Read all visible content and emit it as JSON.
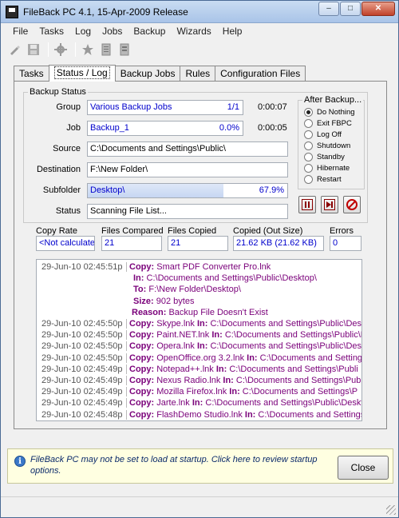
{
  "window": {
    "title": "FileBack PC 4.1, 15-Apr-2009 Release",
    "min": "–",
    "max": "□",
    "close": "✕"
  },
  "menu": [
    "File",
    "Tasks",
    "Log",
    "Jobs",
    "Backup",
    "Wizards",
    "Help"
  ],
  "toolbar": [
    "new-job-icon",
    "save-icon",
    "settings-icon",
    "favorite-icon",
    "document-icon",
    "document-list-icon"
  ],
  "tabs": [
    {
      "label": "Tasks",
      "active": false
    },
    {
      "label": "Status / Log",
      "active": true
    },
    {
      "label": "Backup Jobs",
      "active": false
    },
    {
      "label": "Rules",
      "active": false
    },
    {
      "label": "Configuration Files",
      "active": false
    }
  ],
  "backup_status": {
    "title": "Backup Status",
    "group": {
      "label": "Group",
      "value": "Various Backup Jobs",
      "count": "1/1",
      "time": "0:00:07"
    },
    "job": {
      "label": "Job",
      "value": "Backup_1",
      "percent": "0.0%",
      "progress": 0.0,
      "time": "0:00:05"
    },
    "source": {
      "label": "Source",
      "value": "C:\\Documents and Settings\\Public\\"
    },
    "destination": {
      "label": "Destination",
      "value": "F:\\New Folder\\"
    },
    "subfolder": {
      "label": "Subfolder",
      "value": "Desktop\\",
      "percent": "67.9%",
      "progress": 0.679
    },
    "status": {
      "label": "Status",
      "value": "Scanning File List..."
    }
  },
  "after_backup": {
    "title": "After Backup...",
    "options": [
      {
        "label": "Do Nothing",
        "selected": true
      },
      {
        "label": "Exit FBPC",
        "selected": false
      },
      {
        "label": "Log Off",
        "selected": false
      },
      {
        "label": "Shutdown",
        "selected": false
      },
      {
        "label": "Standby",
        "selected": false
      },
      {
        "label": "Hibernate",
        "selected": false
      },
      {
        "label": "Restart",
        "selected": false
      }
    ]
  },
  "controls": [
    "pause-icon",
    "skip-icon",
    "stop-icon"
  ],
  "stats": {
    "copy_rate": {
      "label": "Copy Rate",
      "value": "<Not calculate"
    },
    "files_compared": {
      "label": "Files Compared",
      "value": "21"
    },
    "files_copied": {
      "label": "Files Copied",
      "value": "21"
    },
    "copied_size": {
      "label": "Copied (Out Size)",
      "value": "21.62 KB (21.62 KB)"
    },
    "errors": {
      "label": "Errors",
      "value": "0"
    }
  },
  "log": [
    {
      "ts": "29-Jun-10 02:45:51p",
      "kw": "Copy:",
      "text": "Smart PDF Converter Pro.lnk"
    },
    {
      "ts": "",
      "kw": "In:",
      "text": "C:\\Documents and Settings\\Public\\Desktop\\"
    },
    {
      "ts": "",
      "kw": "To:",
      "text": "F:\\New Folder\\Desktop\\"
    },
    {
      "ts": "",
      "kw": "Size:",
      "text": "902 bytes"
    },
    {
      "ts": "",
      "kw": "Reason:",
      "text": "Backup File Doesn't Exist"
    },
    {
      "ts": "29-Jun-10 02:45:50p",
      "kw": "Copy:",
      "text": "Skype.lnk",
      "kw2": "In:",
      "text2": "C:\\Documents and Settings\\Public\\Desk"
    },
    {
      "ts": "29-Jun-10 02:45:50p",
      "kw": "Copy:",
      "text": "Paint.NET.lnk",
      "kw2": "In:",
      "text2": "C:\\Documents and Settings\\Public\\Desk"
    },
    {
      "ts": "29-Jun-10 02:45:50p",
      "kw": "Copy:",
      "text": "Opera.lnk",
      "kw2": "In:",
      "text2": "C:\\Documents and Settings\\Public\\Deskt"
    },
    {
      "ts": "29-Jun-10 02:45:50p",
      "kw": "Copy:",
      "text": "OpenOffice.org 3.2.lnk",
      "kw2": "In:",
      "text2": "C:\\Documents and Setting"
    },
    {
      "ts": "29-Jun-10 02:45:49p",
      "kw": "Copy:",
      "text": "Notepad++.lnk",
      "kw2": "In:",
      "text2": "C:\\Documents and Settings\\Publi"
    },
    {
      "ts": "29-Jun-10 02:45:49p",
      "kw": "Copy:",
      "text": "Nexus Radio.lnk",
      "kw2": "In:",
      "text2": "C:\\Documents and Settings\\Public"
    },
    {
      "ts": "29-Jun-10 02:45:49p",
      "kw": "Copy:",
      "text": "Mozilla Firefox.lnk",
      "kw2": "In:",
      "text2": "C:\\Documents and Settings\\P"
    },
    {
      "ts": "29-Jun-10 02:45:49p",
      "kw": "Copy:",
      "text": "Jarte.lnk",
      "kw2": "In:",
      "text2": "C:\\Documents and Settings\\Public\\Deskt"
    },
    {
      "ts": "29-Jun-10 02:45:48p",
      "kw": "Copy:",
      "text": "FlashDemo Studio.lnk",
      "kw2": "In:",
      "text2": "C:\\Documents and Settings"
    }
  ],
  "notice": {
    "text": "FileBack PC may not be set to load at startup.  Click here to review startup options.",
    "close_label": "Close"
  }
}
